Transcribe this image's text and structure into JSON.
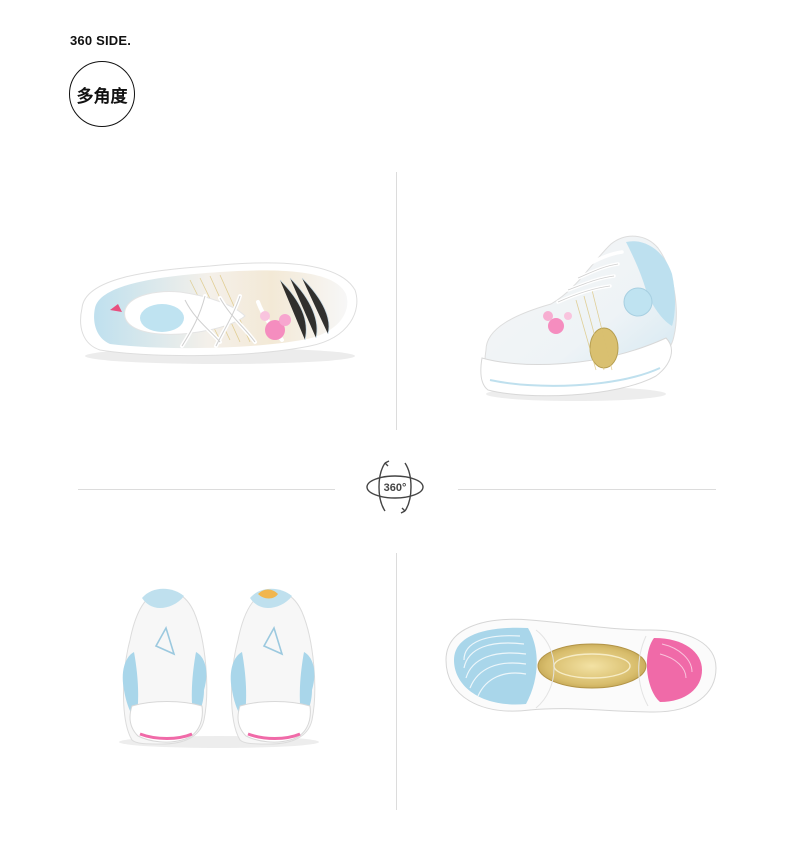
{
  "header": {
    "title": "360 SIDE.",
    "badge_text": "多角度"
  },
  "rotate_icon": {
    "label": "360°",
    "icon": "rotate-360-icon"
  },
  "views": [
    {
      "name": "top-view",
      "icon": "shoe-top-view"
    },
    {
      "name": "three-quarter-view",
      "icon": "shoe-three-quarter-view"
    },
    {
      "name": "rear-view",
      "icon": "shoe-rear-view"
    },
    {
      "name": "sole-view",
      "icon": "shoe-sole-view"
    }
  ],
  "colors": {
    "sky_blue": "#a9d6ea",
    "pink": "#f06aa8",
    "gold": "#d9c070",
    "white": "#ffffff"
  }
}
